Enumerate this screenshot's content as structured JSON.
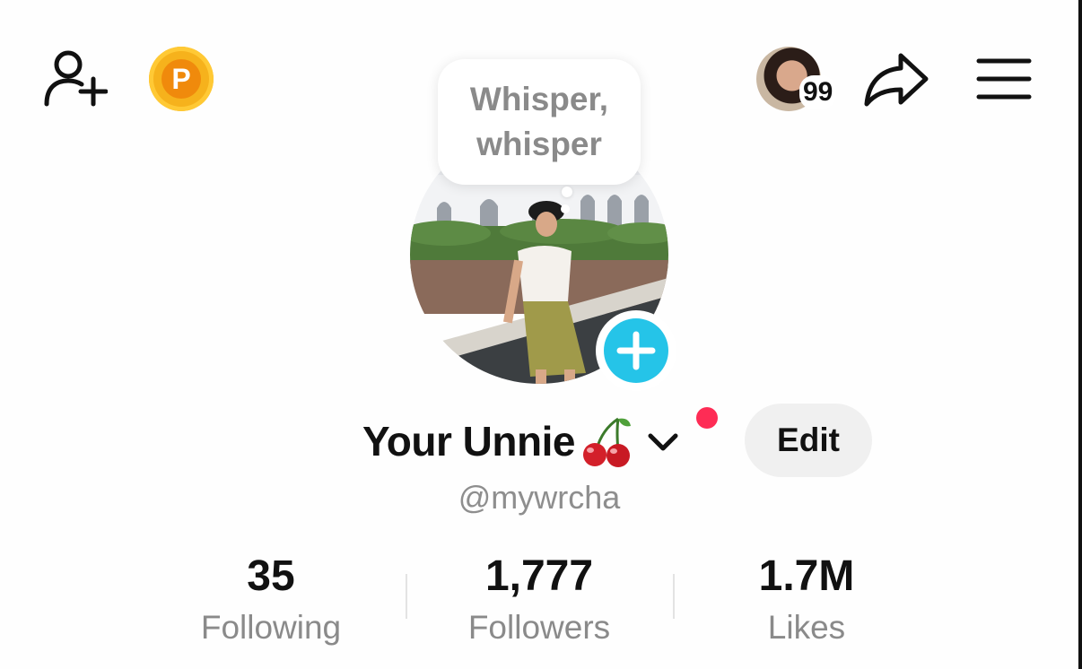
{
  "header": {
    "add_friend_icon": "add-user-icon",
    "coin_icon": "points-coin-icon",
    "coin_letter": "P",
    "story_count": "99",
    "share_icon": "share-arrow-icon",
    "menu_icon": "hamburger-menu-icon"
  },
  "tooltip": {
    "line1": "Whisper,",
    "line2": "whisper"
  },
  "profile": {
    "display_name": "Your Unnie",
    "emoji": "cherries",
    "handle": "@mywrcha",
    "edit_label": "Edit",
    "notification_color": "#fe2c55",
    "accent_color": "#25c4e8"
  },
  "stats": [
    {
      "value": "35",
      "label": "Following"
    },
    {
      "value": "1,777",
      "label": "Followers"
    },
    {
      "value": "1.7M",
      "label": "Likes"
    }
  ]
}
